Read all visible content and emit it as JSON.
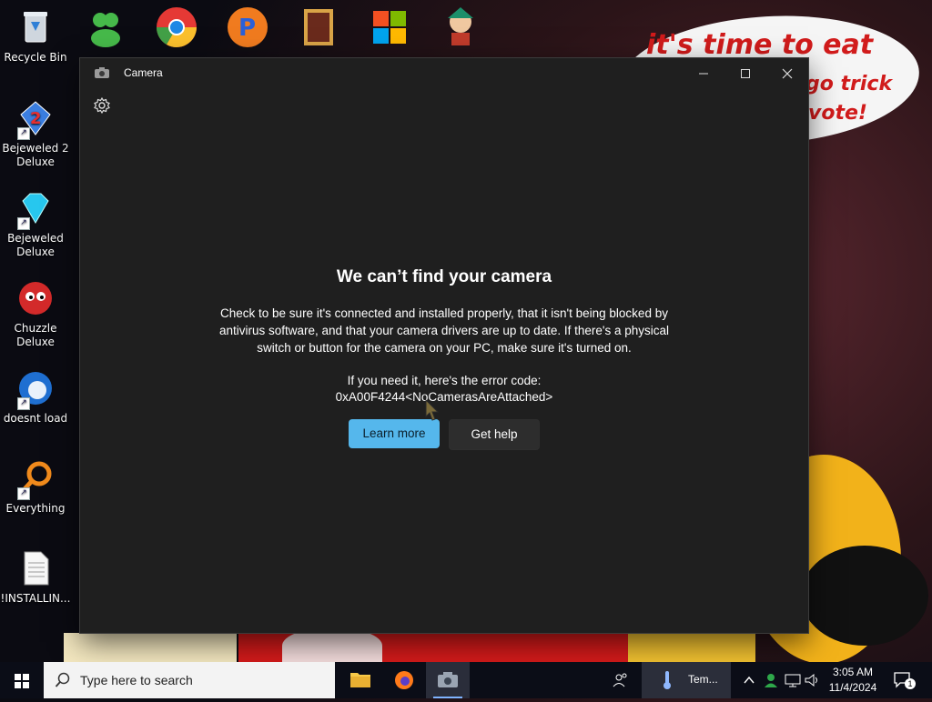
{
  "wallpaper": {
    "bubble_line1": "it's time to eat shit",
    "bubble_line2": "go trick",
    "bubble_line3": "vote!"
  },
  "desktop_icons": [
    {
      "label": "Recycle Bin"
    },
    {
      "label": "Bejeweled 2 Deluxe"
    },
    {
      "label": "Bejeweled Deluxe"
    },
    {
      "label": "Chuzzle Deluxe"
    },
    {
      "label": "doesnt load"
    },
    {
      "label": "Everything"
    },
    {
      "label": "!INSTALLIN..."
    }
  ],
  "window": {
    "title": "Camera",
    "headline": "We can’t find your camera",
    "body": "Check to be sure it's connected and installed properly, that it isn't being blocked by antivirus software, and that your camera drivers are up to date. If there's a physical switch or button for the camera on your PC, make sure it's turned on.",
    "error_label": "If you need it, here's the error code:",
    "error_code": "0xA00F4244<NoCamerasAreAttached>",
    "learn_more": "Learn more",
    "get_help": "Get help"
  },
  "taskbar": {
    "search_placeholder": "Type here to search",
    "weather_text": "Tem...",
    "time": "3:05 AM",
    "date": "11/4/2024",
    "notification_count": "1"
  },
  "colors": {
    "accent": "#55b7ec",
    "window_bg": "#1f1f1f",
    "taskbar_bg": "#0b0d17"
  }
}
